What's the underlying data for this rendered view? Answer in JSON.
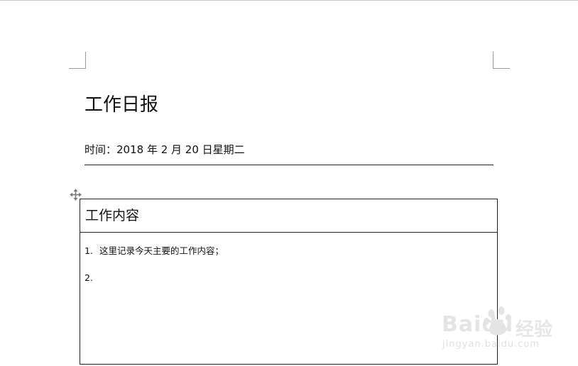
{
  "document": {
    "title": "工作日报",
    "date_line": "时间：2018 年 2 月 20 日星期二",
    "table": {
      "header": "工作内容",
      "items": [
        {
          "number": "1.",
          "text": "这里记录今天主要的工作内容；"
        },
        {
          "number": "2.",
          "text": ""
        }
      ]
    }
  },
  "watermark": {
    "logo_text": "Baidu",
    "product_text": "经验",
    "url": "jingyan.baidu.com"
  },
  "icons": {
    "move_handle": "move-icon",
    "paw": "baidu-paw-icon"
  },
  "colors": {
    "rule": "#222222",
    "crop_marks": "#9a9a9a",
    "watermark": "#e2e2e2"
  }
}
